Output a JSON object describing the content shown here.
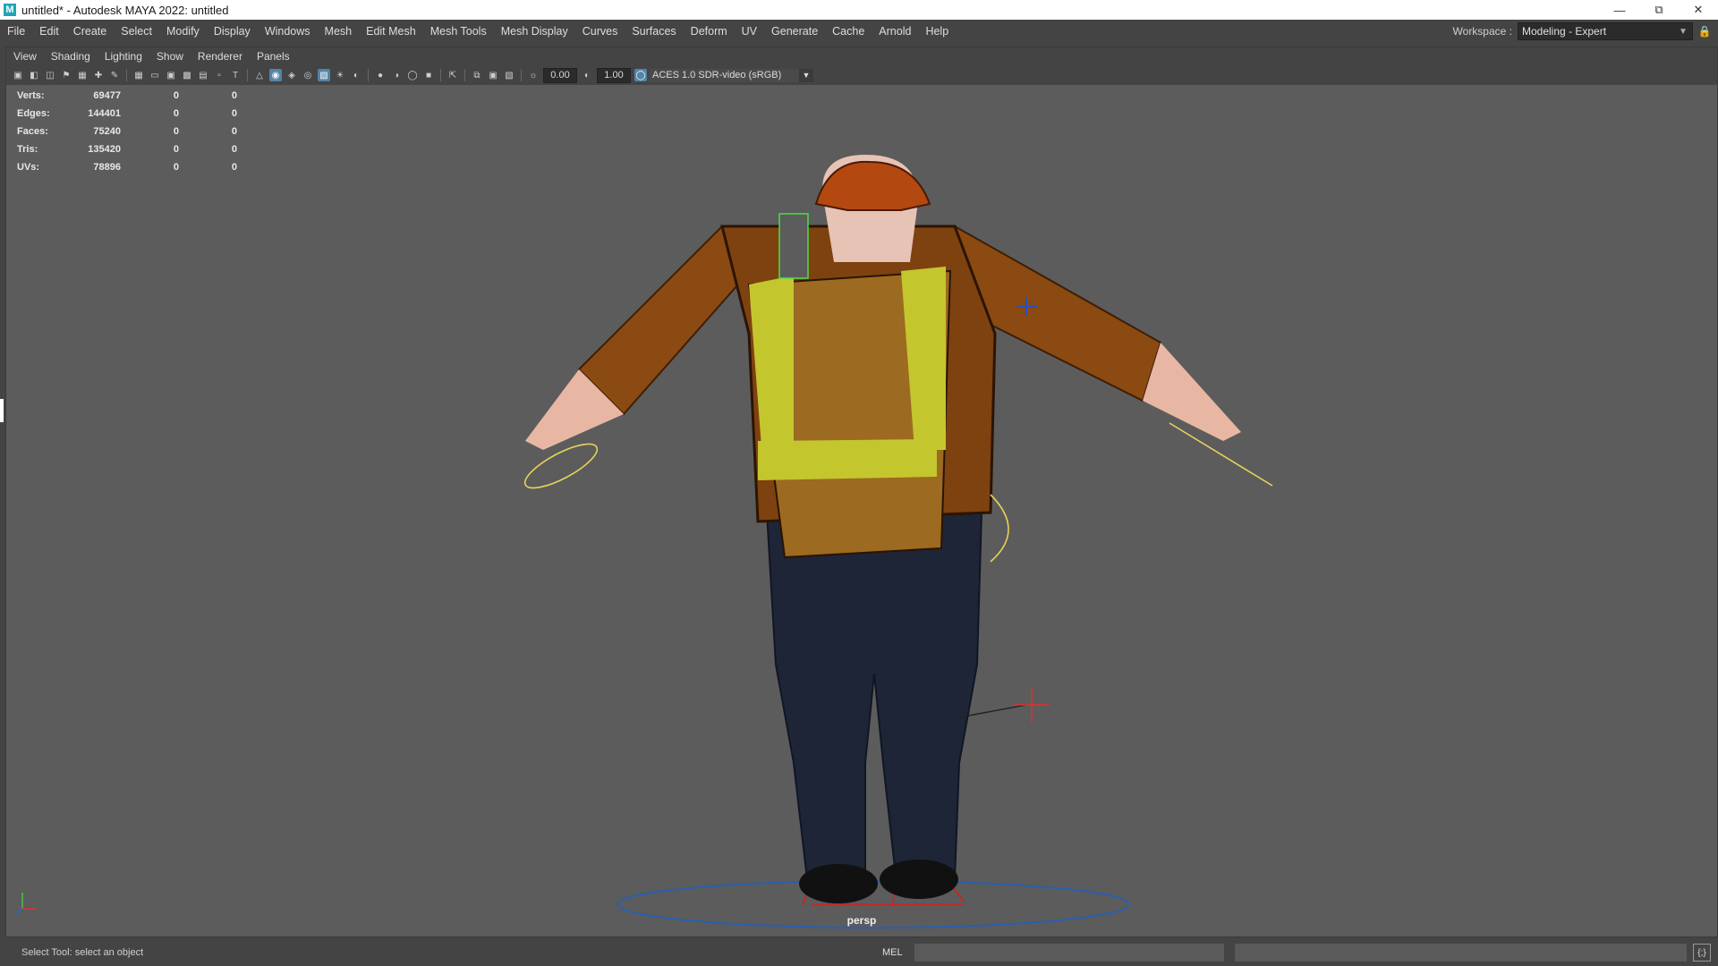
{
  "window": {
    "title": "untitled* - Autodesk MAYA 2022: untitled",
    "app_icon": "M"
  },
  "main_menu": [
    "File",
    "Edit",
    "Create",
    "Select",
    "Modify",
    "Display",
    "Windows",
    "Mesh",
    "Edit Mesh",
    "Mesh Tools",
    "Mesh Display",
    "Curves",
    "Surfaces",
    "Deform",
    "UV",
    "Generate",
    "Cache",
    "Arnold",
    "Help"
  ],
  "workspace": {
    "label": "Workspace :",
    "value": "Modeling - Expert"
  },
  "panel_menu": [
    "View",
    "Shading",
    "Lighting",
    "Show",
    "Renderer",
    "Panels"
  ],
  "toolbar": {
    "exposure": "0.00",
    "gamma": "1.00",
    "color_space": "ACES 1.0 SDR-video (sRGB)"
  },
  "hud": [
    {
      "label": "Verts:",
      "value": "69477",
      "sel": "0",
      "uv": "0"
    },
    {
      "label": "Edges:",
      "value": "144401",
      "sel": "0",
      "uv": "0"
    },
    {
      "label": "Faces:",
      "value": "75240",
      "sel": "0",
      "uv": "0"
    },
    {
      "label": "Tris:",
      "value": "135420",
      "sel": "0",
      "uv": "0"
    },
    {
      "label": "UVs:",
      "value": "78896",
      "sel": "0",
      "uv": "0"
    }
  ],
  "camera_label": "persp",
  "status": {
    "help": "Select Tool: select an object",
    "mel": "MEL"
  },
  "colors": {
    "viewport": "#5c5c5c",
    "accent": "#5285a6",
    "jacket": "#8a4a12",
    "vest": "#c7c930",
    "pants": "#1c2436"
  }
}
